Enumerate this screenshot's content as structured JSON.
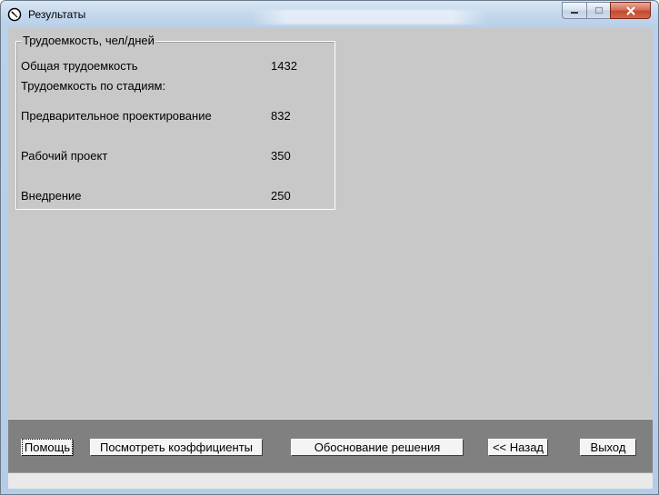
{
  "window": {
    "title": "Результаты"
  },
  "group": {
    "title": "Трудоемкость, чел/дней",
    "total_label": "Общая трудоемкость",
    "total_value": "1432",
    "stages_heading": "Трудоемкость по стадиям:",
    "stages": [
      {
        "label": "Предварительное проектирование",
        "value": "832"
      },
      {
        "label": "Рабочий проект",
        "value": "350"
      },
      {
        "label": "Внедрение",
        "value": "250"
      }
    ]
  },
  "buttons": {
    "help": "Помощь",
    "view_coefficients": "Посмотреть коэффициенты",
    "justification": "Обоснование решения",
    "back": "<< Назад",
    "exit": "Выход"
  },
  "icons": {
    "app": "clock-icon",
    "minimize": "minimize-icon",
    "maximize": "maximize-icon",
    "close": "close-icon"
  },
  "colors": {
    "client_bg": "#c8c8c8",
    "panel_bg": "#808080",
    "close_button": "#c44a2e"
  }
}
